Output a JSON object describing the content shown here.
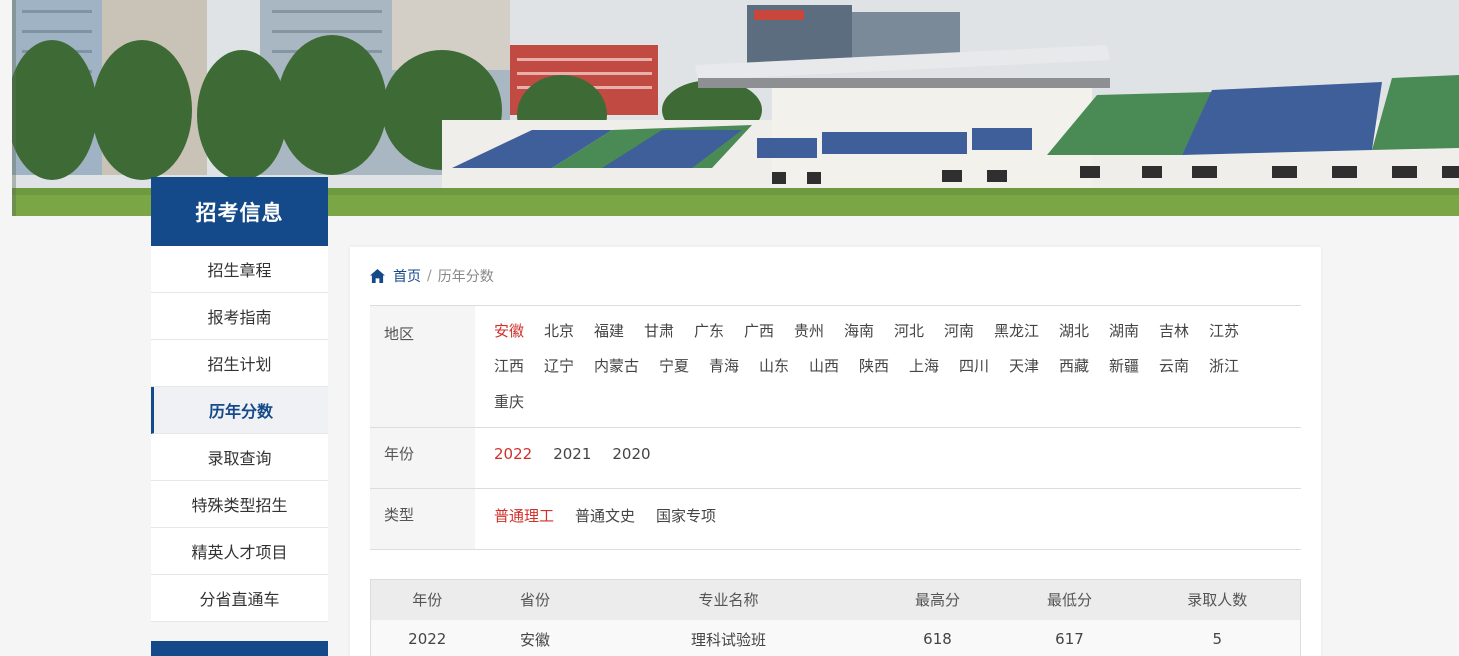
{
  "sidebar": {
    "title": "招考信息",
    "items": [
      {
        "label": "招生章程"
      },
      {
        "label": "报考指南"
      },
      {
        "label": "招生计划"
      },
      {
        "label": "历年分数",
        "active": true
      },
      {
        "label": "录取查询"
      },
      {
        "label": "特殊类型招生"
      },
      {
        "label": "精英人才项目"
      },
      {
        "label": "分省直通车"
      }
    ]
  },
  "breadcrumb": {
    "home": "首页",
    "current": "历年分数"
  },
  "filters": {
    "region": {
      "label": "地区",
      "selected": "安徽",
      "options": [
        "安徽",
        "北京",
        "福建",
        "甘肃",
        "广东",
        "广西",
        "贵州",
        "海南",
        "河北",
        "河南",
        "黑龙江",
        "湖北",
        "湖南",
        "吉林",
        "江苏",
        "江西",
        "辽宁",
        "内蒙古",
        "宁夏",
        "青海",
        "山东",
        "山西",
        "陕西",
        "上海",
        "四川",
        "天津",
        "西藏",
        "新疆",
        "云南",
        "浙江",
        "重庆"
      ]
    },
    "year": {
      "label": "年份",
      "selected": "2022",
      "options": [
        "2022",
        "2021",
        "2020"
      ]
    },
    "type": {
      "label": "类型",
      "selected": "普通理工",
      "options": [
        "普通理工",
        "普通文史",
        "国家专项"
      ]
    }
  },
  "table": {
    "headers": [
      "年份",
      "省份",
      "专业名称",
      "最高分",
      "最低分",
      "录取人数"
    ],
    "rows": [
      [
        "2022",
        "安徽",
        "理科试验班",
        "618",
        "617",
        "5"
      ]
    ]
  },
  "colors": {
    "primary": "#144a8a",
    "selected": "#d0302a"
  },
  "icons": {
    "breadcrumb_home": "home-icon"
  }
}
